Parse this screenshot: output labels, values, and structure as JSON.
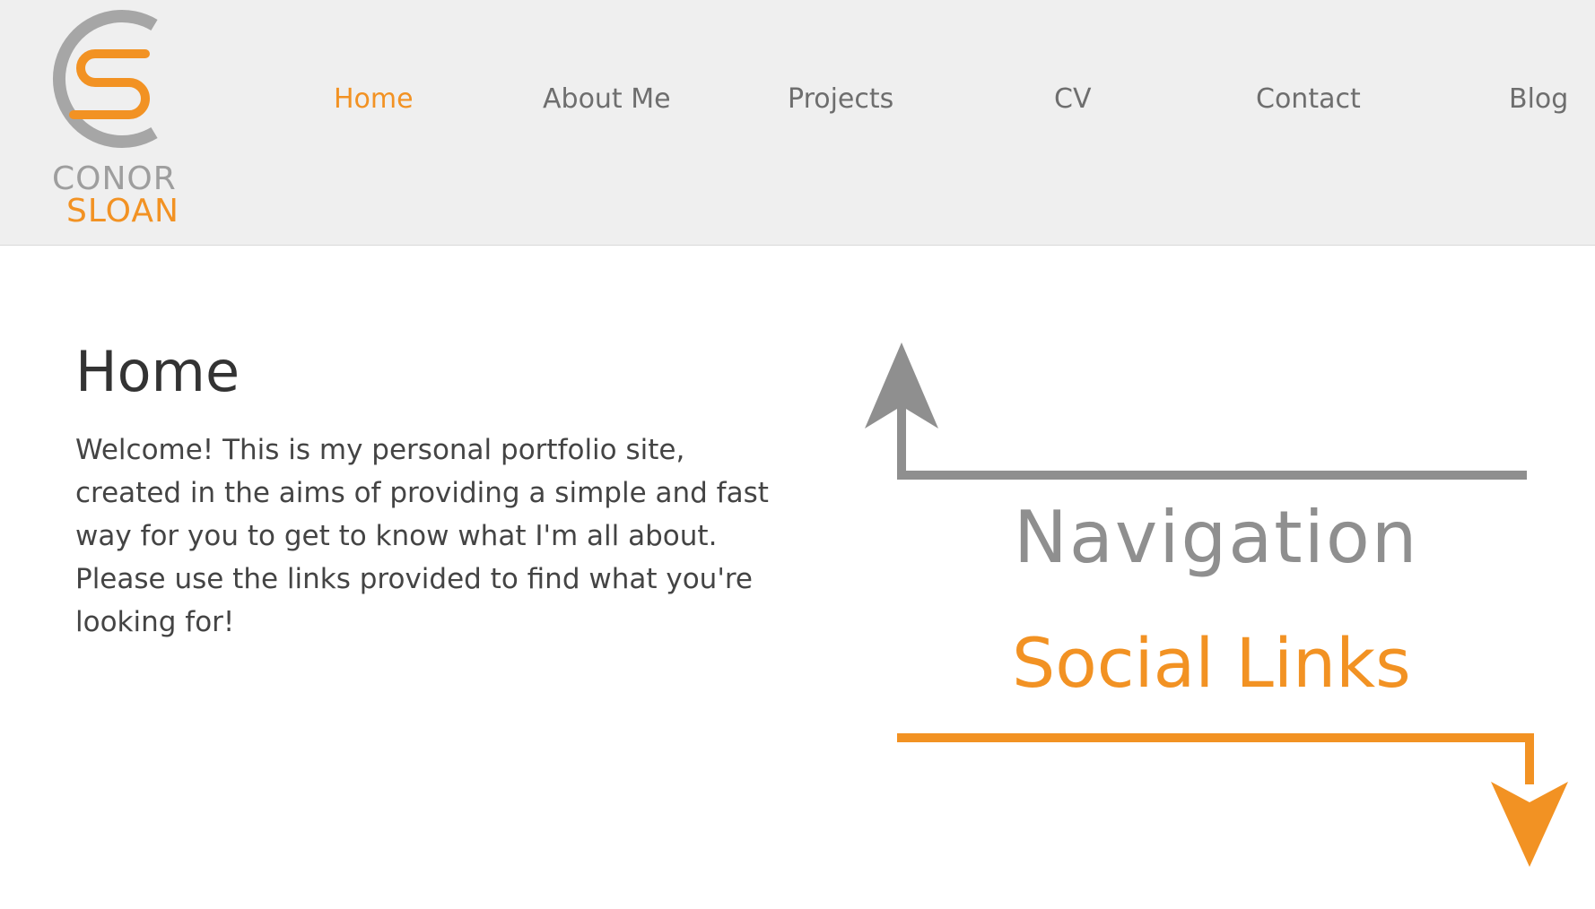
{
  "header": {
    "logo": {
      "first_name": "CONOR",
      "last_name": "SLOAN",
      "colors": {
        "gray": "#a6a6a6",
        "orange": "#f29223"
      }
    },
    "nav": {
      "items": [
        {
          "label": "Home",
          "active": true
        },
        {
          "label": "About Me",
          "active": false
        },
        {
          "label": "Projects",
          "active": false
        },
        {
          "label": "CV",
          "active": false
        },
        {
          "label": "Contact",
          "active": false
        },
        {
          "label": "Blog",
          "active": false
        }
      ]
    }
  },
  "main": {
    "title": "Home",
    "text": "Welcome! This is my personal portfolio site, created in the aims of providing a simple and fast way for you to get to know what I'm all about. Please use the links provided to find what you're looking for!"
  },
  "diagram": {
    "navigation_label": "Navigation",
    "social_label": "Social Links",
    "colors": {
      "navigation": "#8f8f8f",
      "social": "#f29223"
    },
    "icons": {
      "navigation": "arrow-up-icon",
      "social": "arrow-down-icon"
    }
  },
  "colors": {
    "accent": "#f29223",
    "header_bg": "#efefef",
    "nav_text": "#6e6e6e"
  }
}
